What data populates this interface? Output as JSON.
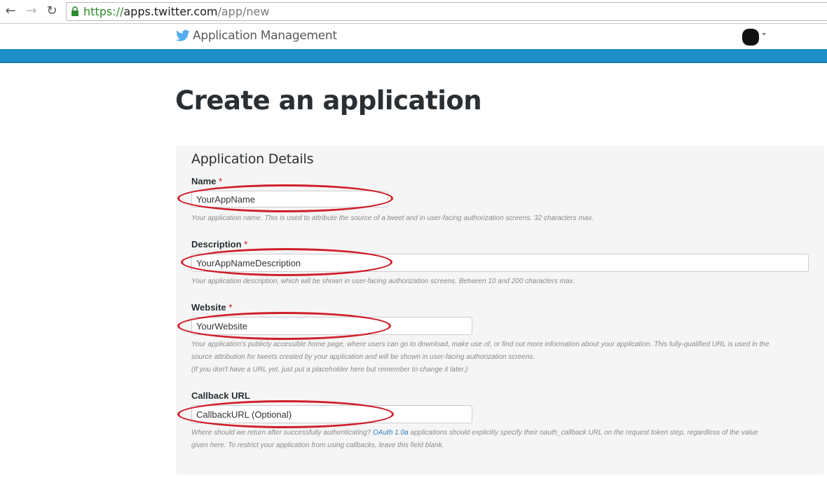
{
  "browser": {
    "url_scheme": "https://",
    "url_host": "apps.twitter.com",
    "url_path": "/app/new"
  },
  "header": {
    "title": "Application Management"
  },
  "page": {
    "title": "Create an application"
  },
  "form": {
    "section_title": "Application Details",
    "required_marker": "*",
    "name": {
      "label": "Name",
      "value": "YourAppName",
      "help": "Your application name. This is used to attribute the source of a tweet and in user-facing authorization screens. 32 characters max."
    },
    "description": {
      "label": "Description",
      "value": "YourAppNameDescription",
      "help": "Your application description, which will be shown in user-facing authorization screens. Between 10 and 200 characters max."
    },
    "website": {
      "label": "Website",
      "value": "YourWebsite",
      "help_line1": "Your application's publicly accessible home page, where users can go to download, make use of, or find out more information about your application. This fully-qualified URL is used in the",
      "help_line2": "source attribution for tweets created by your application and will be shown in user-facing authorization screens.",
      "help_line3": "(If you don't have a URL yet, just put a placeholder here but remember to change it later.)"
    },
    "callback": {
      "label": "Callback URL",
      "value": "CallbackURL (Optional)",
      "help_before_link": "Where should we return after successfully authenticating? ",
      "help_link": "OAuth 1.0a",
      "help_after_link": " applications should explicitly specify their oauth_callback URL on the request token step, regardless of the value",
      "help_line2": "given here. To restrict your application from using callbacks, leave this field blank."
    }
  },
  "icons": [
    "back-arrow-icon",
    "forward-arrow-icon",
    "reload-icon",
    "lock-icon",
    "twitter-bird-icon",
    "caret-down-icon"
  ],
  "colors": {
    "brand_blue": "#1b8fc8",
    "annotation_red": "#cf1f2a",
    "secure_green": "#2c8a2c"
  }
}
